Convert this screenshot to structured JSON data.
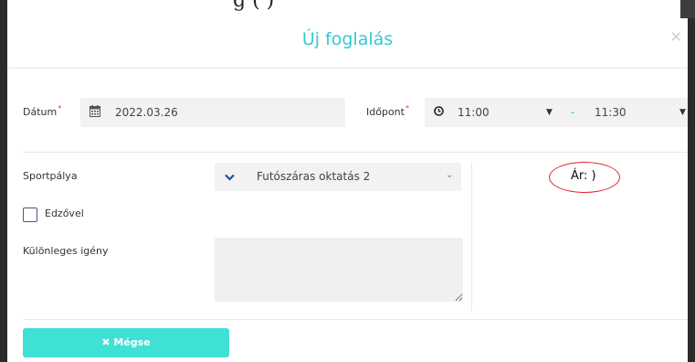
{
  "background_partial_text": "g  (    )",
  "modal": {
    "title": "Új foglalás",
    "close_label": "×"
  },
  "date": {
    "label": "Dátum",
    "required_mark": "*",
    "icon": "calendar-icon",
    "value": "2022.03.26"
  },
  "time": {
    "label": "Időpont",
    "required_mark": "*",
    "icon": "clock-icon",
    "start": "11:00",
    "separator": "-",
    "end": "11:30"
  },
  "court": {
    "label": "Sportpálya",
    "selected": "Futószáras oktatás 2"
  },
  "coach": {
    "label": "Edzővel",
    "checked": false
  },
  "special_request": {
    "label": "Különleges igény",
    "value": ""
  },
  "price": {
    "text": "Ár: )"
  },
  "footer": {
    "cancel_label": "Mégse",
    "cancel_icon": "close-icon"
  },
  "colors": {
    "accent": "#35c8d4",
    "button": "#3fe0d6",
    "required": "#e0364a",
    "annotation": "#e0242f"
  }
}
